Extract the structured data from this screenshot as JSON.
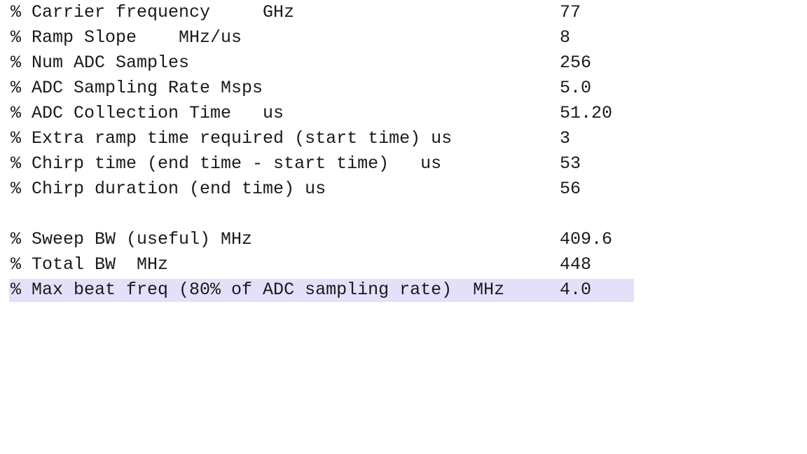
{
  "editor": {
    "background_color": "#ffffff",
    "text_color": "#1a1a1a",
    "selection_color": "#E3E1FA",
    "lines": [
      {
        "id": "carrier-frequency",
        "text": "% Carrier frequency     GHz",
        "value": "77",
        "selected": false,
        "blank": false
      },
      {
        "id": "ramp-slope",
        "text": "% Ramp Slope    MHz/us",
        "value": "8",
        "selected": false,
        "blank": false
      },
      {
        "id": "num-adc-samples",
        "text": "% Num ADC Samples",
        "value": "256",
        "selected": false,
        "blank": false
      },
      {
        "id": "adc-sampling-rate",
        "text": "% ADC Sampling Rate Msps",
        "value": "5.0",
        "selected": false,
        "blank": false
      },
      {
        "id": "adc-collection-time",
        "text": "% ADC Collection Time   us",
        "value": "51.20",
        "selected": false,
        "blank": false
      },
      {
        "id": "extra-ramp-time",
        "text": "% Extra ramp time required (start time) us",
        "value": "3",
        "selected": false,
        "blank": false
      },
      {
        "id": "chirp-time",
        "text": "% Chirp time (end time - start time)   us",
        "value": "53",
        "selected": false,
        "blank": false
      },
      {
        "id": "chirp-duration",
        "text": "% Chirp duration (end time) us",
        "value": "56",
        "selected": false,
        "blank": false
      },
      {
        "id": "spacer-1",
        "text": "",
        "value": "",
        "selected": false,
        "blank": true
      },
      {
        "id": "sweep-bw-useful",
        "text": "% Sweep BW (useful) MHz",
        "value": "409.6",
        "selected": false,
        "blank": false
      },
      {
        "id": "total-bw",
        "text": "% Total BW  MHz",
        "value": "448",
        "selected": false,
        "blank": false
      },
      {
        "id": "max-beat-freq",
        "text": "% Max beat freq (80% of ADC sampling rate)  MHz",
        "value": "4.0",
        "selected": true,
        "blank": false
      }
    ]
  }
}
